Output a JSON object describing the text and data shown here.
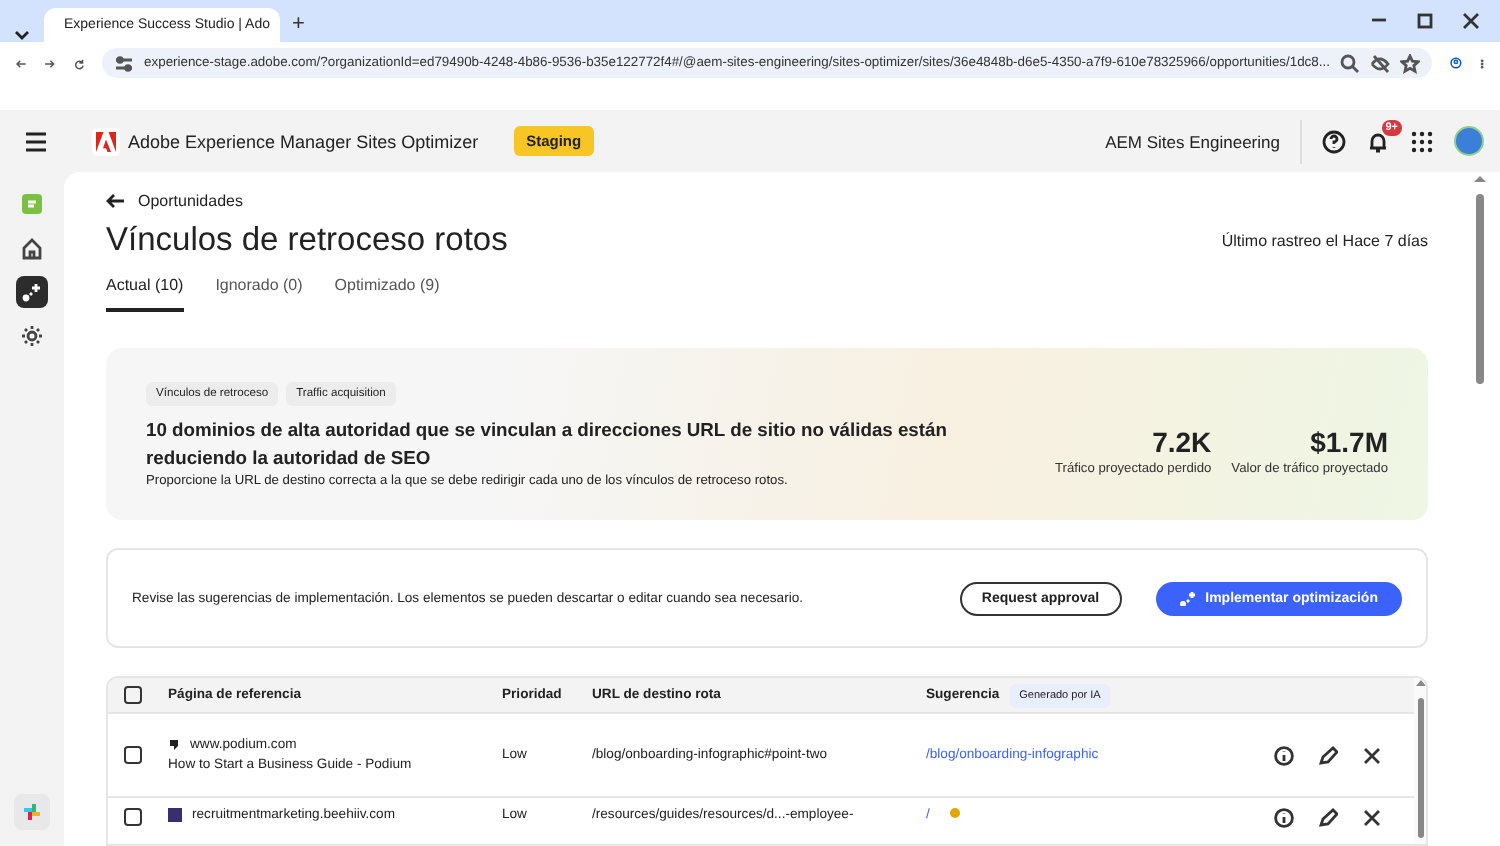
{
  "browser": {
    "tab_title": "Experience Success Studio | Ado",
    "new_tab": "+",
    "url": "experience-stage.adobe.com/?organizationId=ed79490b-4248-4b86-9536-b35e122772f4#/@aem-sites-engineering/sites-optimizer/sites/36e4848b-d6e5-4350-a7f9-610e78325966/opportunities/1dc8..."
  },
  "header": {
    "product": "Adobe Experience Manager Sites Optimizer",
    "badge": "Staging",
    "org": "AEM Sites Engineering",
    "notification_count": "9+"
  },
  "sidebar": {
    "items": [
      {
        "kind": "app",
        "selected": false
      },
      {
        "kind": "home",
        "selected": false
      },
      {
        "kind": "opportunities",
        "selected": true
      },
      {
        "kind": "settings",
        "selected": false
      }
    ]
  },
  "breadcrumb": "Oportunidades",
  "title": "Vínculos de retroceso rotos",
  "last_crawl": "Último rastreo el Hace 7 días",
  "tabs": [
    {
      "label": "Actual (10)",
      "selected": true
    },
    {
      "label": "Ignorado (0)",
      "selected": false
    },
    {
      "label": "Optimizado (9)",
      "selected": false
    }
  ],
  "summary": {
    "tags": [
      "Vínculos de retroceso",
      "Traffic acquisition"
    ],
    "headline": "10 dominios de alta autoridad que se vinculan a direcciones URL de sitio no válidas están reduciendo la autoridad de SEO",
    "description": "Proporcione la URL de destino correcta a la que se debe redirigir cada uno de los vínculos de retroceso rotos.",
    "metrics": [
      {
        "value": "7.2K",
        "label": "Tráfico proyectado perdido"
      },
      {
        "value": "$1.7M",
        "label": "Valor de tráfico proyectado"
      }
    ]
  },
  "actions": {
    "message": "Revise las sugerencias de implementación. Los elementos se pueden descartar o editar cuando sea necesario.",
    "buttons": [
      {
        "label": "Request approval",
        "kind": "secondary"
      },
      {
        "label": "Implementar optimización",
        "kind": "primary"
      }
    ]
  },
  "table": {
    "select_all_checked": false,
    "columns": [
      "Página de referencia",
      "Prioridad",
      "URL de destino rota",
      "Sugerencia"
    ],
    "suggestion_badge": "Generado por IA",
    "rows": [
      {
        "checked": false,
        "domain": "www.podium.com",
        "page_title": "How to Start a Business Guide - Podium",
        "priority": "Low",
        "broken_url": "/blog/onboarding-infographic#point-two",
        "suggestion": "/blog/onboarding-infographic"
      },
      {
        "checked": false,
        "domain": "recruitmentmarketing.beehiiv.com",
        "priority": "Low",
        "broken_url": "/resources/guides/resources/d...-employee-",
        "suggestion": "/"
      }
    ]
  }
}
